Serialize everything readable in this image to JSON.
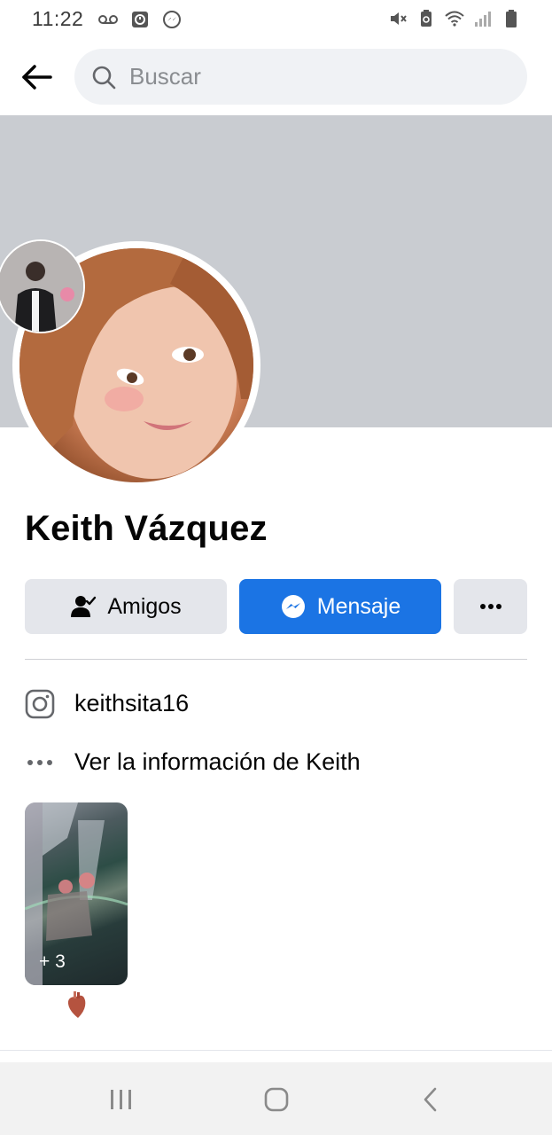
{
  "status_bar": {
    "time": "11:22",
    "left_icons": [
      "voicemail-icon",
      "clock-app-icon",
      "messenger-notification-icon"
    ],
    "right_icons": [
      "mute-icon",
      "battery-saver-icon",
      "wifi-icon",
      "signal-icon",
      "battery-icon"
    ]
  },
  "header": {
    "back_icon": "back-arrow-icon",
    "search_placeholder": "Buscar"
  },
  "profile": {
    "name": "Keith Vázquez"
  },
  "actions": {
    "friends_label": "Amigos",
    "message_label": "Mensaje",
    "more_icon": "more-dots-icon"
  },
  "info": {
    "instagram_handle": "keithsita16",
    "see_info": "Ver la información de Keith"
  },
  "featured": {
    "count": "+ 3",
    "caption_icon": "anatomical-heart-emoji"
  },
  "nav": {
    "icons": [
      "recent-apps-icon",
      "home-icon",
      "back-icon"
    ]
  },
  "colors": {
    "accent": "#1b74e4",
    "cover": "#c9ccd1",
    "button_gray": "#e4e6eb",
    "search_bg": "#f0f2f5"
  }
}
